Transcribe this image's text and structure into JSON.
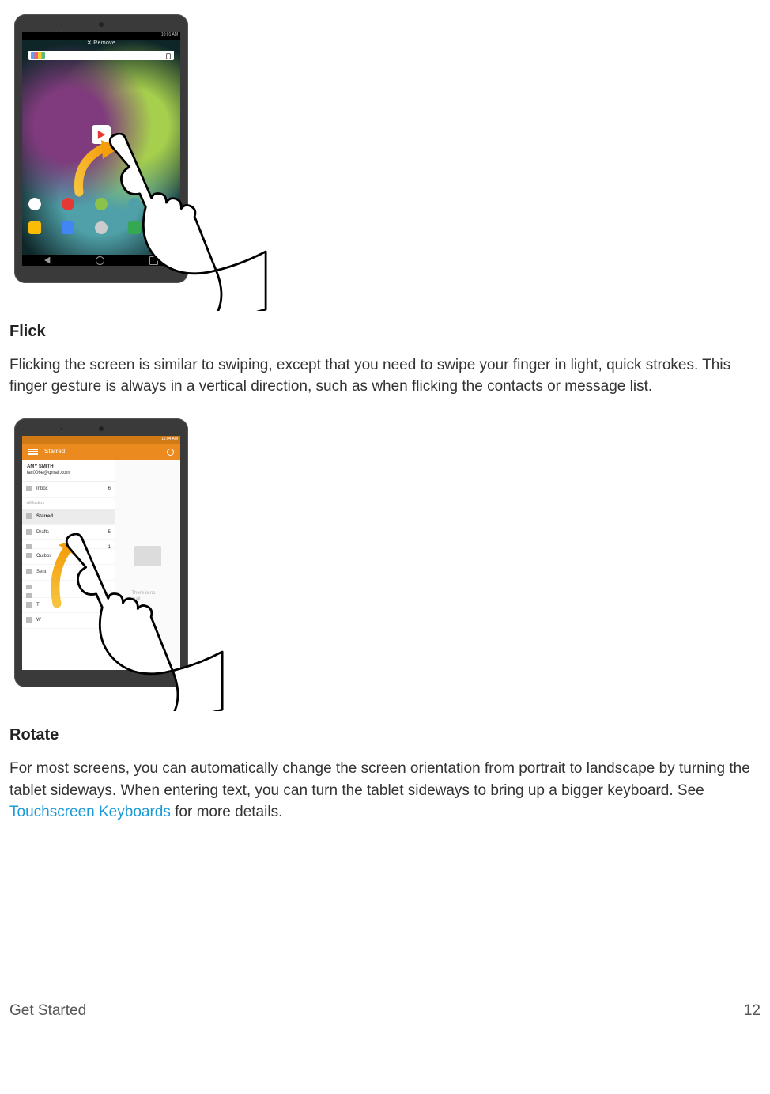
{
  "illustration1": {
    "status_time": "10:01 AM",
    "drag_label": "✕  Remove",
    "icons_top": [
      "#ffffff",
      "#e53935",
      "#8bc34a",
      "#4fa0a8",
      "#4285f4"
    ],
    "icons_bottom": [
      "#fbbc05",
      "#4285f4",
      "#cccccc",
      "#34a853",
      "#ffb300"
    ]
  },
  "sections": {
    "flick": {
      "heading": "Flick",
      "text": "Flicking the screen is similar to swiping, except that you need to swipe your finger in light, quick strokes. This finger gesture is always in a vertical direction, such as when flicking the contacts or message list."
    },
    "rotate": {
      "heading": "Rotate",
      "text_before_link": "For most screens, you can automatically change the screen orientation from portrait to landscape by turning the tablet sideways. When entering text, you can turn the tablet sideways to bring up a bigger keyboard. See ",
      "link_text": "Touchscreen Keyboards",
      "text_after_link": " for more details."
    }
  },
  "illustration2": {
    "status_time": "11:04 AM",
    "appbar_title": "Starred",
    "account": {
      "name": "AMY SMITH",
      "email": "iac006e@qmail.com"
    },
    "label_all": "All folders",
    "items": [
      {
        "label": "Inbox",
        "count": "6"
      },
      {
        "label": "Starred",
        "selected": true
      },
      {
        "label": "Drafts",
        "count": "5"
      },
      {
        "label": "",
        "count": "1"
      },
      {
        "label": "Outbox"
      },
      {
        "label": "Sent"
      },
      {
        "label": ""
      },
      {
        "label": ""
      },
      {
        "label": "T"
      },
      {
        "label": "W"
      }
    ],
    "empty_text": "There is no mail"
  },
  "footer": {
    "section": "Get Started",
    "page": "12"
  }
}
